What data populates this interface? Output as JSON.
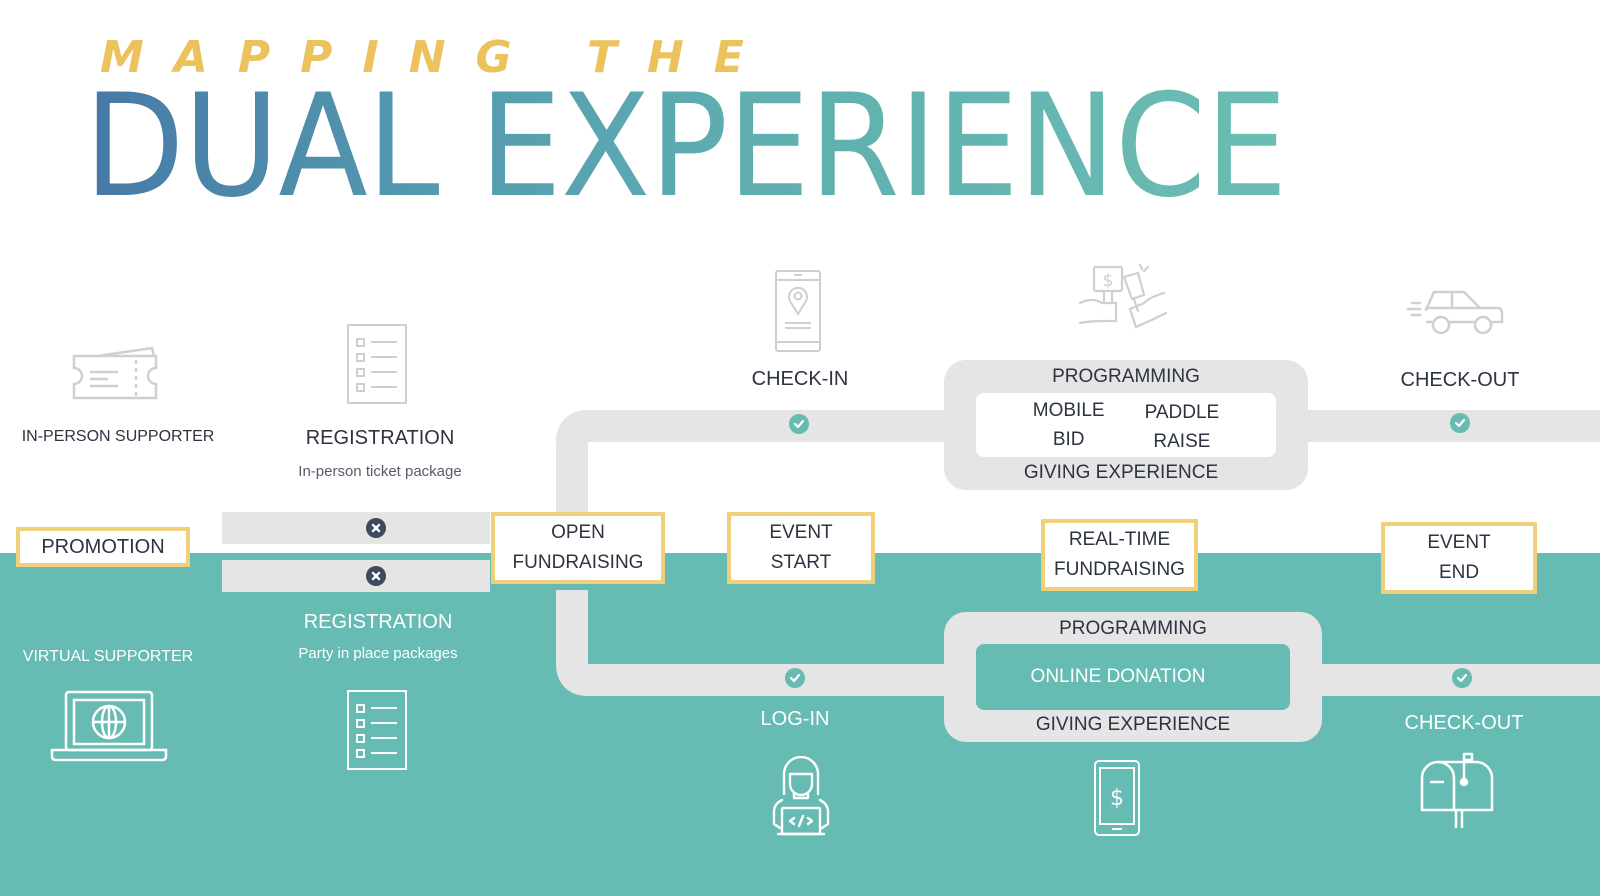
{
  "title": {
    "kicker": "MAPPING THE",
    "main": "DUAL EXPERIENCE"
  },
  "colors": {
    "teal": "#66bbb2",
    "gold": "#efcf7a",
    "title_gold": "#ebc25c",
    "track": "#e5e5e5",
    "dark_text": "#2d3341",
    "x_badge": "#3e4a5e",
    "gradient_start": "#4679a6",
    "gradient_end": "#6bbdb2"
  },
  "stages": {
    "promotion": "PROMOTION",
    "open_fundraising": [
      "OPEN",
      "FUNDRAISING"
    ],
    "event_start": [
      "EVENT",
      "START"
    ],
    "real_time_fundraising": [
      "REAL-TIME",
      "FUNDRAISING"
    ],
    "event_end": [
      "EVENT",
      "END"
    ]
  },
  "in_person": {
    "supporter_label": "IN-PERSON SUPPORTER",
    "supporter_icon": "ticket-icon",
    "registration_title": "REGISTRATION",
    "registration_subtitle": "In-person ticket package",
    "registration_icon": "checklist-icon",
    "checkin_label": "CHECK-IN",
    "checkin_icon": "phone-location-icon",
    "programming_top": "PROGRAMMING",
    "programming_items": [
      [
        "MOBILE",
        "BID"
      ],
      [
        "PADDLE",
        "RAISE"
      ]
    ],
    "programming_bottom": "GIVING EXPERIENCE",
    "programming_icon": "paddle-raise-icon",
    "checkout_label": "CHECK-OUT",
    "checkout_icon": "car-icon"
  },
  "virtual": {
    "supporter_label": "VIRTUAL SUPPORTER",
    "supporter_icon": "laptop-globe-icon",
    "registration_title": "REGISTRATION",
    "registration_subtitle": "Party in place packages",
    "registration_icon": "checklist-icon",
    "login_label": "LOG-IN",
    "login_icon": "person-laptop-icon",
    "programming_top": "PROGRAMMING",
    "programming_item": "ONLINE DONATION",
    "programming_bottom": "GIVING EXPERIENCE",
    "programming_icon": "phone-dollar-icon",
    "checkout_label": "CHECK-OUT",
    "checkout_icon": "mailbox-icon"
  }
}
